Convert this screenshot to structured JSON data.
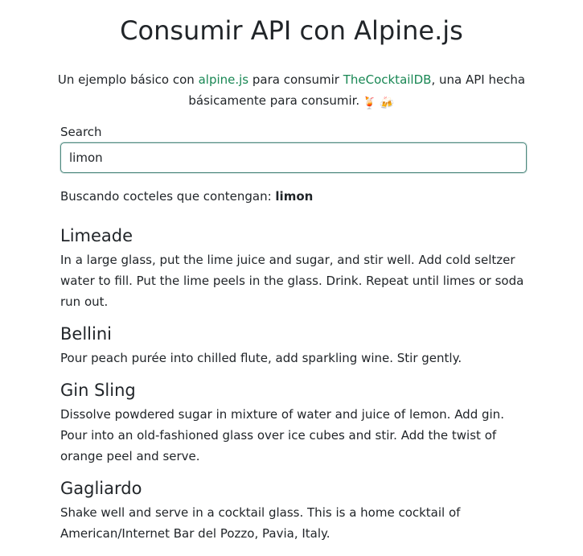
{
  "header": {
    "title": "Consumir API con Alpine.js"
  },
  "intro": {
    "text_before": "Un ejemplo básico con ",
    "alpine_link": "alpine.js",
    "text_middle": " para consumir ",
    "cocktaildb_link": "TheCocktailDB",
    "text_after": ", una API hecha básicamente para consumir.",
    "emoji_1": "🍹",
    "emoji_2": "🍻",
    "link_color": "#198754"
  },
  "search": {
    "label": "Search",
    "value": "limon",
    "placeholder": ""
  },
  "status": {
    "prefix": "Buscando cocteles que contengan: ",
    "term": "limon"
  },
  "results": [
    {
      "name": "Limeade",
      "instructions": "In a large glass, put the lime juice and sugar, and stir well. Add cold seltzer water to fill. Put the lime peels in the glass. Drink. Repeat until limes or soda run out."
    },
    {
      "name": "Bellini",
      "instructions": "Pour peach purée into chilled flute, add sparkling wine. Stir gently."
    },
    {
      "name": "Gin Sling",
      "instructions": "Dissolve powdered sugar in mixture of water and juice of lemon. Add gin. Pour into an old-fashioned glass over ice cubes and stir. Add the twist of orange peel and serve."
    },
    {
      "name": "Gagliardo",
      "instructions": "Shake well and serve in a cocktail glass. This is a home cocktail of American/Internet Bar del Pozzo, Pavia, Italy."
    }
  ]
}
